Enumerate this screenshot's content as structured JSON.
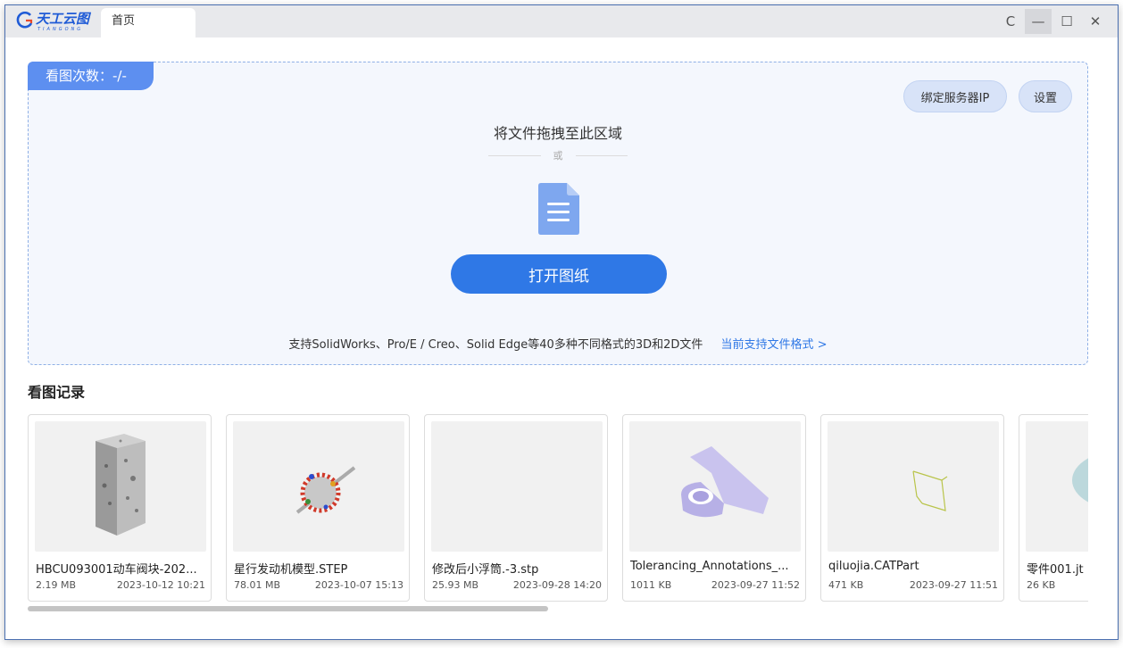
{
  "window": {
    "logo_text": "天工云图",
    "logo_sub": "TIANGONG",
    "tab_label": "首页",
    "controls": {
      "refresh": "C",
      "minimize": "—",
      "maximize": "☐",
      "close": "✕"
    }
  },
  "dropzone": {
    "view_count": "看图次数：-/-",
    "bind_ip_label": "绑定服务器IP",
    "settings_label": "设置",
    "drop_hint": "将文件拖拽至此区域",
    "or_text": "或",
    "open_label": "打开图纸",
    "support_text": "支持SolidWorks、Pro/E / Creo、Solid Edge等40多种不同格式的3D和2D文件",
    "support_link": "当前支持文件格式 >"
  },
  "history": {
    "title": "看图记录",
    "items": [
      {
        "name": "HBCU093001动车阀块-202...",
        "size": "2.19 MB",
        "date": "2023-10-12 10:21",
        "thumb": "block-icon"
      },
      {
        "name": "星行发动机模型.STEP",
        "size": "78.01 MB",
        "date": "2023-10-07 15:13",
        "thumb": "engine-icon"
      },
      {
        "name": "修改后小浮筒.-3.stp",
        "size": "25.93 MB",
        "date": "2023-09-28 14:20",
        "thumb": "empty"
      },
      {
        "name": "Tolerancing_Annotations_...",
        "size": "1011 KB",
        "date": "2023-09-27 11:52",
        "thumb": "bracket-icon"
      },
      {
        "name": "qiluojia.CATPart",
        "size": "471 KB",
        "date": "2023-09-27 11:51",
        "thumb": "wire-icon"
      },
      {
        "name": "零件001.jt",
        "size": "26 KB",
        "date": "",
        "thumb": "sphere-icon"
      }
    ]
  },
  "colors": {
    "accent": "#2f78e6",
    "badge": "#5d8ff0",
    "dropzone_bg": "#f4f7fd"
  }
}
